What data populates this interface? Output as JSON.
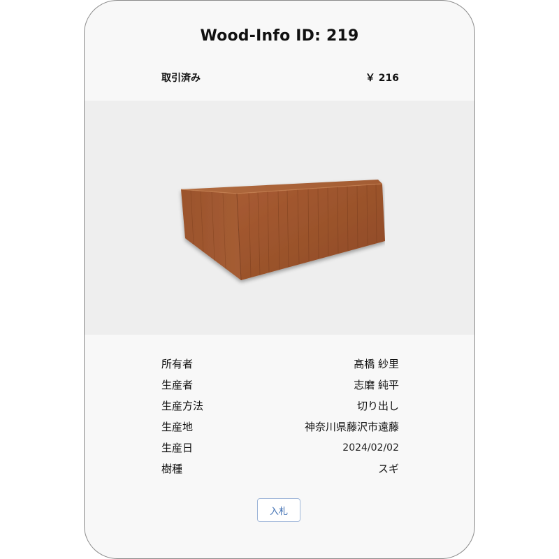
{
  "card": {
    "title": "Wood-Info ID: 219",
    "status": "取引済み",
    "price": "￥ 216"
  },
  "image": {
    "subject": "wood-block",
    "background_color": "#eeeeee",
    "wood_color": "#a0582f"
  },
  "details": [
    {
      "label": "所有者",
      "value": "髙橋 紗里"
    },
    {
      "label": "生産者",
      "value": "志磨 純平"
    },
    {
      "label": "生産方法",
      "value": "切り出し"
    },
    {
      "label": "生産地",
      "value": "神奈川県藤沢市遠藤"
    },
    {
      "label": "生産日",
      "value": "2024/02/02"
    },
    {
      "label": "樹種",
      "value": "スギ"
    }
  ],
  "actions": {
    "bid_label": "入札"
  },
  "colors": {
    "card_background": "#f8f8f8",
    "button_text": "#3f6fb3",
    "button_border": "#9fb6d8"
  }
}
